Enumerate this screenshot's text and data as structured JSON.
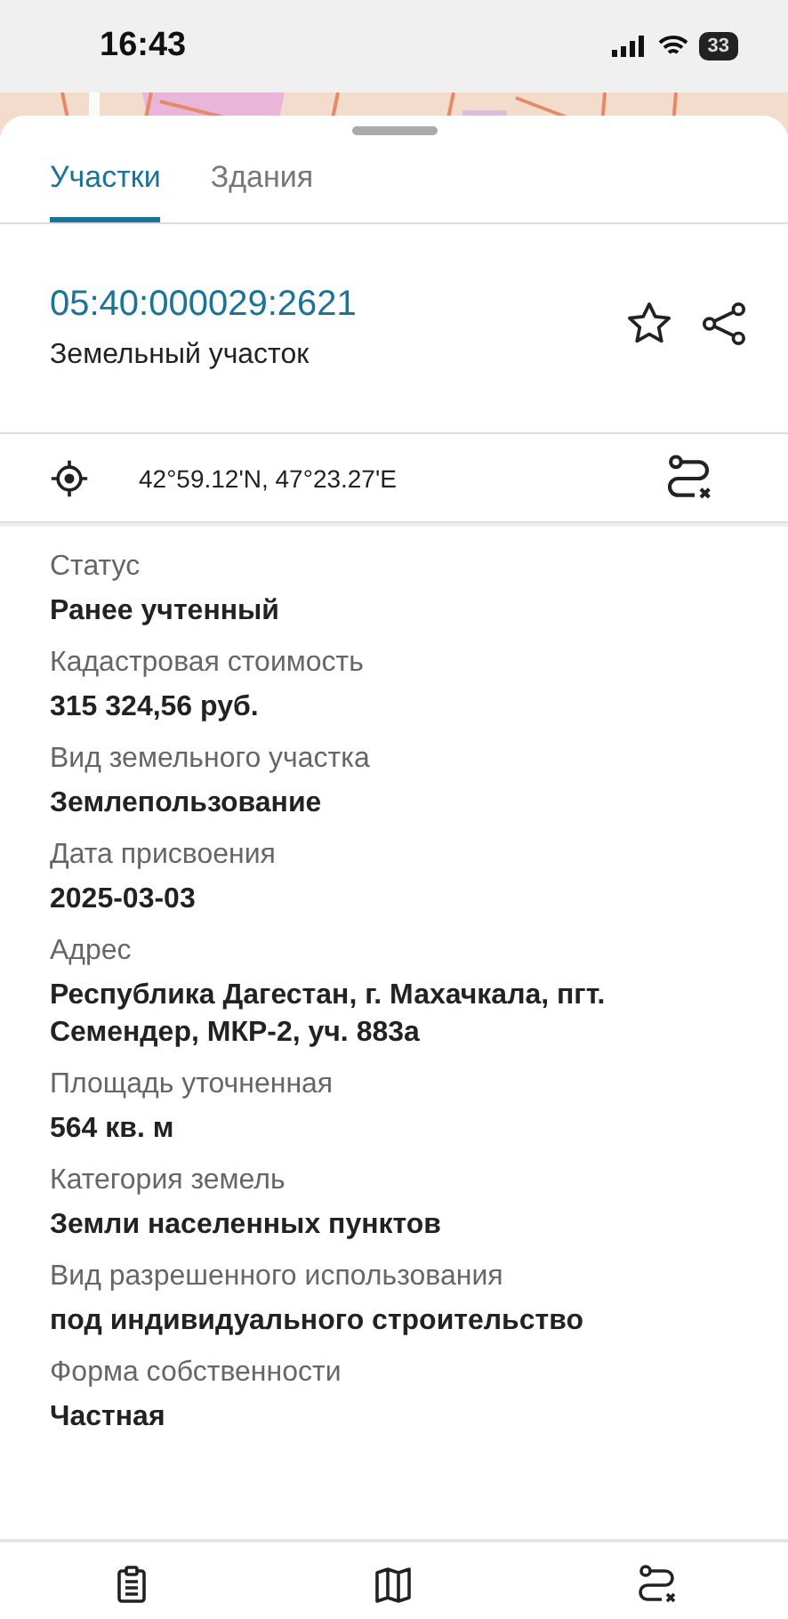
{
  "status_bar": {
    "time": "16:43",
    "battery": "33"
  },
  "tabs": [
    {
      "label": "Участки",
      "selected": true
    },
    {
      "label": "Здания",
      "selected": false
    }
  ],
  "object": {
    "number": "05:40:000029:2621",
    "type": "Земельный участок",
    "favorite": false
  },
  "coordinates": "42°59.12'N, 47°23.27'E",
  "properties": [
    {
      "label": "Статус",
      "value": "Ранее учтенный"
    },
    {
      "label": "Кадастровая стоимость",
      "value": "315 324,56 руб."
    },
    {
      "label": "Вид земельного участка",
      "value": "Землепользование"
    },
    {
      "label": "Дата присвоения",
      "value": "2025-03-03"
    },
    {
      "label": "Адрес",
      "value": "Республика Дагестан, г. Махачкала, пгт. Семендер, МКР-2, уч. 883а"
    },
    {
      "label": "Площадь уточненная",
      "value": "564 кв. м"
    },
    {
      "label": "Категория земель",
      "value": "Земли населенных пунктов"
    },
    {
      "label": "Вид разрешенного использования",
      "value": "под индивидуального строительство"
    },
    {
      "label": "Форма собственности",
      "value": "Частная"
    }
  ],
  "bottom_nav": [
    {
      "kind": "clipboard"
    },
    {
      "kind": "map"
    },
    {
      "kind": "route"
    }
  ]
}
